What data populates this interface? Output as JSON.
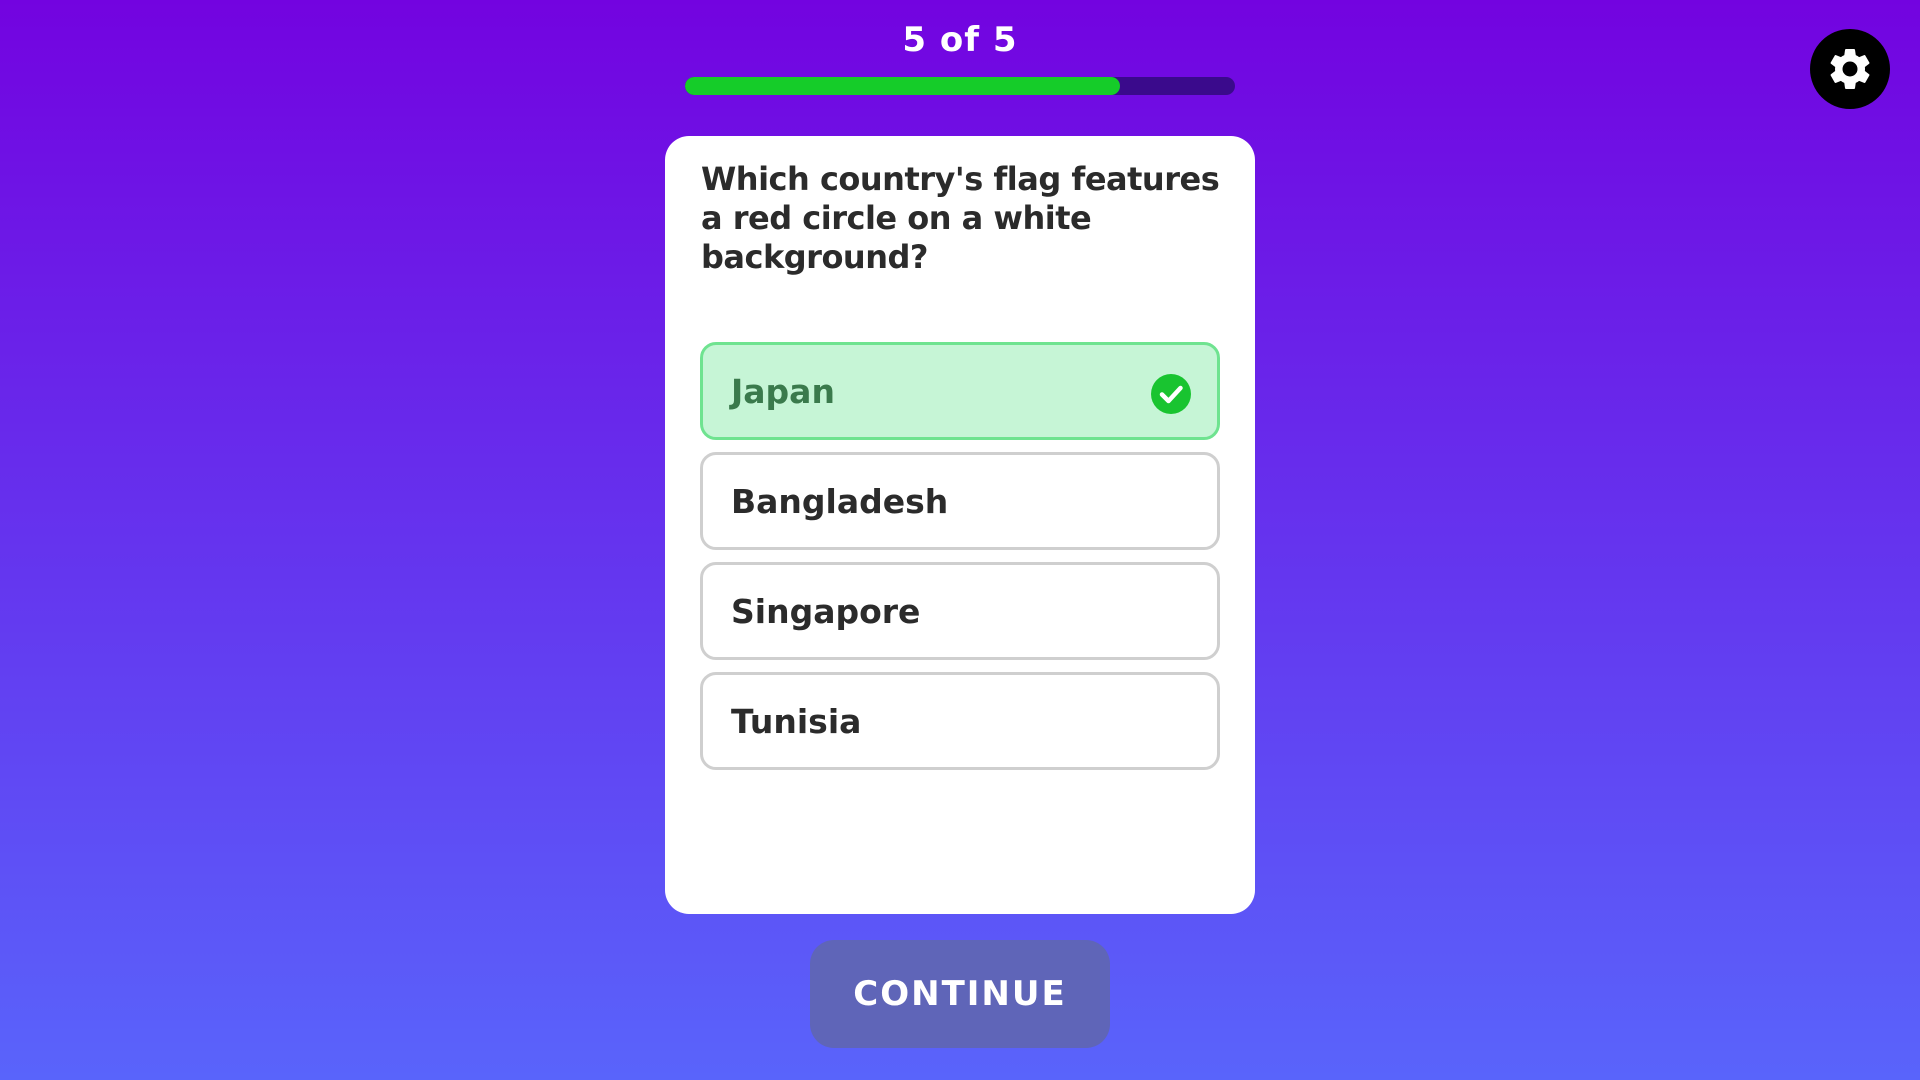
{
  "header": {
    "progress_label": "5 of 5",
    "progress_fraction": 0.79
  },
  "settings": {
    "icon": "gear-icon"
  },
  "question": {
    "text": "Which country's flag features a red circle on a white background?"
  },
  "options": [
    {
      "label": "Japan",
      "state": "correct"
    },
    {
      "label": "Bangladesh",
      "state": "default"
    },
    {
      "label": "Singapore",
      "state": "default"
    },
    {
      "label": "Tunisia",
      "state": "default"
    }
  ],
  "continue_button": {
    "label": "CONTINUE"
  },
  "colors": {
    "background_top": "#7303e0",
    "background_bottom": "#5964fb",
    "progress_fill": "#15cc29",
    "progress_track": "#3a0a8c",
    "correct_bg": "#c6f5d6",
    "correct_border": "#6fe390",
    "check_green": "#19c430",
    "continue_bg": "#5f65b8"
  }
}
